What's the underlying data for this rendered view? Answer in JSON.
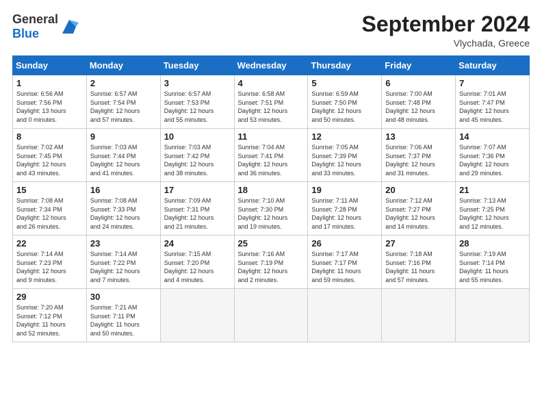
{
  "header": {
    "logo_general": "General",
    "logo_blue": "Blue",
    "title": "September 2024",
    "location": "Vlychada, Greece"
  },
  "weekdays": [
    "Sunday",
    "Monday",
    "Tuesday",
    "Wednesday",
    "Thursday",
    "Friday",
    "Saturday"
  ],
  "weeks": [
    [
      {
        "day": "1",
        "info": "Sunrise: 6:56 AM\nSunset: 7:56 PM\nDaylight: 13 hours\nand 0 minutes."
      },
      {
        "day": "2",
        "info": "Sunrise: 6:57 AM\nSunset: 7:54 PM\nDaylight: 12 hours\nand 57 minutes."
      },
      {
        "day": "3",
        "info": "Sunrise: 6:57 AM\nSunset: 7:53 PM\nDaylight: 12 hours\nand 55 minutes."
      },
      {
        "day": "4",
        "info": "Sunrise: 6:58 AM\nSunset: 7:51 PM\nDaylight: 12 hours\nand 53 minutes."
      },
      {
        "day": "5",
        "info": "Sunrise: 6:59 AM\nSunset: 7:50 PM\nDaylight: 12 hours\nand 50 minutes."
      },
      {
        "day": "6",
        "info": "Sunrise: 7:00 AM\nSunset: 7:48 PM\nDaylight: 12 hours\nand 48 minutes."
      },
      {
        "day": "7",
        "info": "Sunrise: 7:01 AM\nSunset: 7:47 PM\nDaylight: 12 hours\nand 45 minutes."
      }
    ],
    [
      {
        "day": "8",
        "info": "Sunrise: 7:02 AM\nSunset: 7:45 PM\nDaylight: 12 hours\nand 43 minutes."
      },
      {
        "day": "9",
        "info": "Sunrise: 7:03 AM\nSunset: 7:44 PM\nDaylight: 12 hours\nand 41 minutes."
      },
      {
        "day": "10",
        "info": "Sunrise: 7:03 AM\nSunset: 7:42 PM\nDaylight: 12 hours\nand 38 minutes."
      },
      {
        "day": "11",
        "info": "Sunrise: 7:04 AM\nSunset: 7:41 PM\nDaylight: 12 hours\nand 36 minutes."
      },
      {
        "day": "12",
        "info": "Sunrise: 7:05 AM\nSunset: 7:39 PM\nDaylight: 12 hours\nand 33 minutes."
      },
      {
        "day": "13",
        "info": "Sunrise: 7:06 AM\nSunset: 7:37 PM\nDaylight: 12 hours\nand 31 minutes."
      },
      {
        "day": "14",
        "info": "Sunrise: 7:07 AM\nSunset: 7:36 PM\nDaylight: 12 hours\nand 29 minutes."
      }
    ],
    [
      {
        "day": "15",
        "info": "Sunrise: 7:08 AM\nSunset: 7:34 PM\nDaylight: 12 hours\nand 26 minutes."
      },
      {
        "day": "16",
        "info": "Sunrise: 7:08 AM\nSunset: 7:33 PM\nDaylight: 12 hours\nand 24 minutes."
      },
      {
        "day": "17",
        "info": "Sunrise: 7:09 AM\nSunset: 7:31 PM\nDaylight: 12 hours\nand 21 minutes."
      },
      {
        "day": "18",
        "info": "Sunrise: 7:10 AM\nSunset: 7:30 PM\nDaylight: 12 hours\nand 19 minutes."
      },
      {
        "day": "19",
        "info": "Sunrise: 7:11 AM\nSunset: 7:28 PM\nDaylight: 12 hours\nand 17 minutes."
      },
      {
        "day": "20",
        "info": "Sunrise: 7:12 AM\nSunset: 7:27 PM\nDaylight: 12 hours\nand 14 minutes."
      },
      {
        "day": "21",
        "info": "Sunrise: 7:13 AM\nSunset: 7:25 PM\nDaylight: 12 hours\nand 12 minutes."
      }
    ],
    [
      {
        "day": "22",
        "info": "Sunrise: 7:14 AM\nSunset: 7:23 PM\nDaylight: 12 hours\nand 9 minutes."
      },
      {
        "day": "23",
        "info": "Sunrise: 7:14 AM\nSunset: 7:22 PM\nDaylight: 12 hours\nand 7 minutes."
      },
      {
        "day": "24",
        "info": "Sunrise: 7:15 AM\nSunset: 7:20 PM\nDaylight: 12 hours\nand 4 minutes."
      },
      {
        "day": "25",
        "info": "Sunrise: 7:16 AM\nSunset: 7:19 PM\nDaylight: 12 hours\nand 2 minutes."
      },
      {
        "day": "26",
        "info": "Sunrise: 7:17 AM\nSunset: 7:17 PM\nDaylight: 11 hours\nand 59 minutes."
      },
      {
        "day": "27",
        "info": "Sunrise: 7:18 AM\nSunset: 7:16 PM\nDaylight: 11 hours\nand 57 minutes."
      },
      {
        "day": "28",
        "info": "Sunrise: 7:19 AM\nSunset: 7:14 PM\nDaylight: 11 hours\nand 55 minutes."
      }
    ],
    [
      {
        "day": "29",
        "info": "Sunrise: 7:20 AM\nSunset: 7:12 PM\nDaylight: 11 hours\nand 52 minutes."
      },
      {
        "day": "30",
        "info": "Sunrise: 7:21 AM\nSunset: 7:11 PM\nDaylight: 11 hours\nand 50 minutes."
      },
      {
        "day": "",
        "info": ""
      },
      {
        "day": "",
        "info": ""
      },
      {
        "day": "",
        "info": ""
      },
      {
        "day": "",
        "info": ""
      },
      {
        "day": "",
        "info": ""
      }
    ]
  ]
}
